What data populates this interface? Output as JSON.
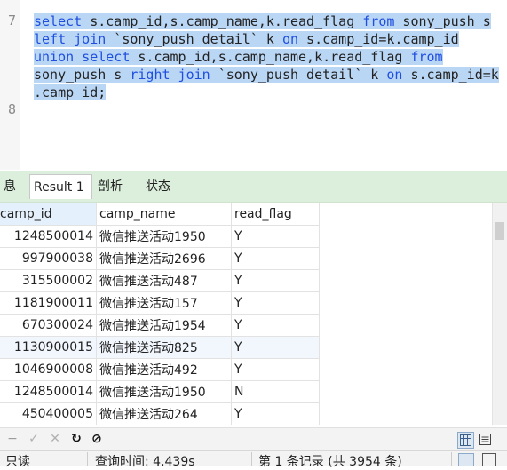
{
  "editor": {
    "line_numbers": [
      "7",
      "8"
    ],
    "code_lines": [
      [
        {
          "t": "select",
          "k": true
        },
        {
          "t": " s.camp_id,s.camp_name,k.read_flag ",
          "k": false
        },
        {
          "t": "from",
          "k": true
        },
        {
          "t": " sony_push s",
          "k": false
        }
      ],
      [
        {
          "t": "left join",
          "k": true
        },
        {
          "t": " `sony_push detail` k ",
          "k": false
        },
        {
          "t": "on",
          "k": true
        },
        {
          "t": " s.camp_id=k.camp_id",
          "k": false
        }
      ],
      [
        {
          "t": "union select",
          "k": true
        },
        {
          "t": " s.camp_id,s.camp_name,k.read_flag ",
          "k": false
        },
        {
          "t": "from",
          "k": true
        }
      ],
      [
        {
          "t": "sony_push s ",
          "k": false
        },
        {
          "t": "right join",
          "k": true
        },
        {
          "t": " `sony_push detail` k ",
          "k": false
        },
        {
          "t": "on",
          "k": true
        },
        {
          "t": " s.camp_id=k",
          "k": false
        }
      ],
      [
        {
          "t": ".camp_id;",
          "k": false
        }
      ]
    ]
  },
  "tabs": {
    "messages": "息",
    "result": "Result 1",
    "profile": "剖析",
    "status": "状态"
  },
  "grid": {
    "columns": [
      "camp_id",
      "camp_name",
      "read_flag"
    ],
    "rows": [
      [
        "1248500014",
        "微信推送活动1950",
        "Y"
      ],
      [
        "997900038",
        "微信推送活动2696",
        "Y"
      ],
      [
        "315500002",
        "微信推送活动487",
        "Y"
      ],
      [
        "1181900011",
        "微信推送活动157",
        "Y"
      ],
      [
        "670300024",
        "微信推送活动1954",
        "Y"
      ],
      [
        "1130900015",
        "微信推送活动825",
        "Y"
      ],
      [
        "1046900008",
        "微信推送活动492",
        "Y"
      ],
      [
        "1248500014",
        "微信推送活动1950",
        "N"
      ],
      [
        "450400005",
        "微信推送活动264",
        "Y"
      ]
    ],
    "highlight_row_index": 5
  },
  "toolbar": {
    "icons": [
      "minus-icon",
      "check-icon",
      "cross-icon",
      "refresh-icon",
      "stop-icon"
    ],
    "glyphs": [
      "−",
      "✓",
      "✕",
      "↻",
      "⊘"
    ]
  },
  "status": {
    "mode": "只读",
    "query_time": "查询时间: 4.439s",
    "record": "第 1 条记录 (共 3954 条)"
  },
  "colors": {
    "selection": "#bad6f5",
    "keyword": "#1f4fe0",
    "tabbar": "#dcefdc",
    "header_active": "#e4f0fb"
  }
}
